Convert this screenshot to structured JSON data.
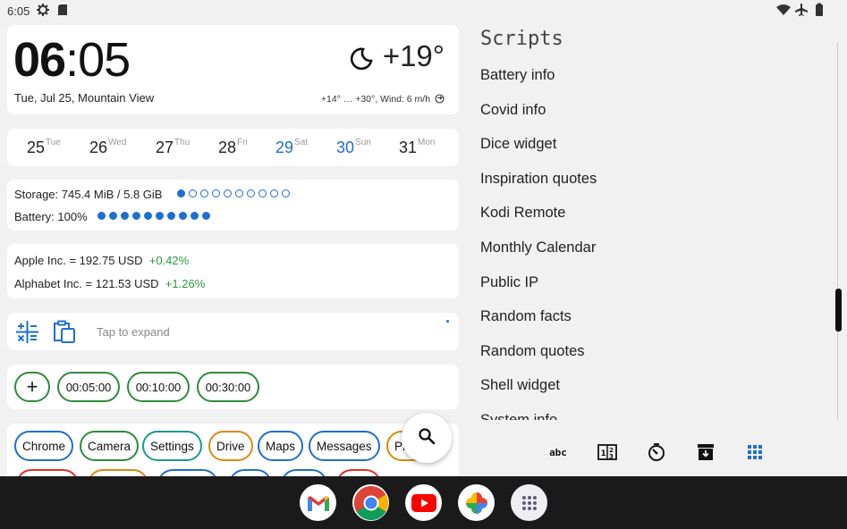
{
  "status_bar": {
    "time": "6:05"
  },
  "clock": {
    "hours": "06",
    "separator": ":",
    "minutes": "05",
    "date": "Tue, Jul 25, Mountain View",
    "temperature": "+19°",
    "weather_detail": "+14° … +30°, Wind: 6 m/h"
  },
  "calendar": {
    "days": [
      {
        "day": "25",
        "weekday": "Tue"
      },
      {
        "day": "26",
        "weekday": "Wed"
      },
      {
        "day": "27",
        "weekday": "Thu"
      },
      {
        "day": "28",
        "weekday": "Fri"
      },
      {
        "day": "29",
        "weekday": "Sat"
      },
      {
        "day": "30",
        "weekday": "Sun"
      },
      {
        "day": "31",
        "weekday": "Mon"
      }
    ]
  },
  "system": {
    "storage_label": "Storage: 745.4 MiB / 5.8 GiB",
    "storage_level": 0.1,
    "battery_label": "Battery: 100%",
    "battery_level": 1.0
  },
  "stocks": [
    {
      "name": "Apple Inc.",
      "eq": "=",
      "price": "192.75 USD",
      "change": "+0.42%"
    },
    {
      "name": "Alphabet Inc.",
      "eq": "=",
      "price": "121.53 USD",
      "change": "+1.26%"
    }
  ],
  "notes": {
    "placeholder": "Tap to expand"
  },
  "timers": {
    "add": "+",
    "items": [
      "00:05:00",
      "00:10:00",
      "00:30:00"
    ]
  },
  "apps": [
    {
      "label": "Chrome",
      "color": "#1e6fcf"
    },
    {
      "label": "Camera",
      "color": "#2e8b3a"
    },
    {
      "label": "Settings",
      "color": "#1a9a8a"
    },
    {
      "label": "Drive",
      "color": "#d98a12"
    },
    {
      "label": "Maps",
      "color": "#1e6fcf"
    },
    {
      "label": "Messages",
      "color": "#1e6fcf"
    },
    {
      "label": "Pl",
      "color": "#d98a12"
    }
  ],
  "scripts": {
    "title": "Scripts",
    "items": [
      "Battery info",
      "Covid info",
      "Dice widget",
      "Inspiration quotes",
      "Kodi Remote",
      "Monthly Calendar",
      "Public IP",
      "Random facts",
      "Random quotes",
      "Shell widget",
      "System info"
    ]
  },
  "bottom_bar": {
    "abc_label": "abc"
  },
  "colors": {
    "accent": "#1e6fcf",
    "positive": "#2e9a3a",
    "timer_border": "#2e8b3a"
  }
}
